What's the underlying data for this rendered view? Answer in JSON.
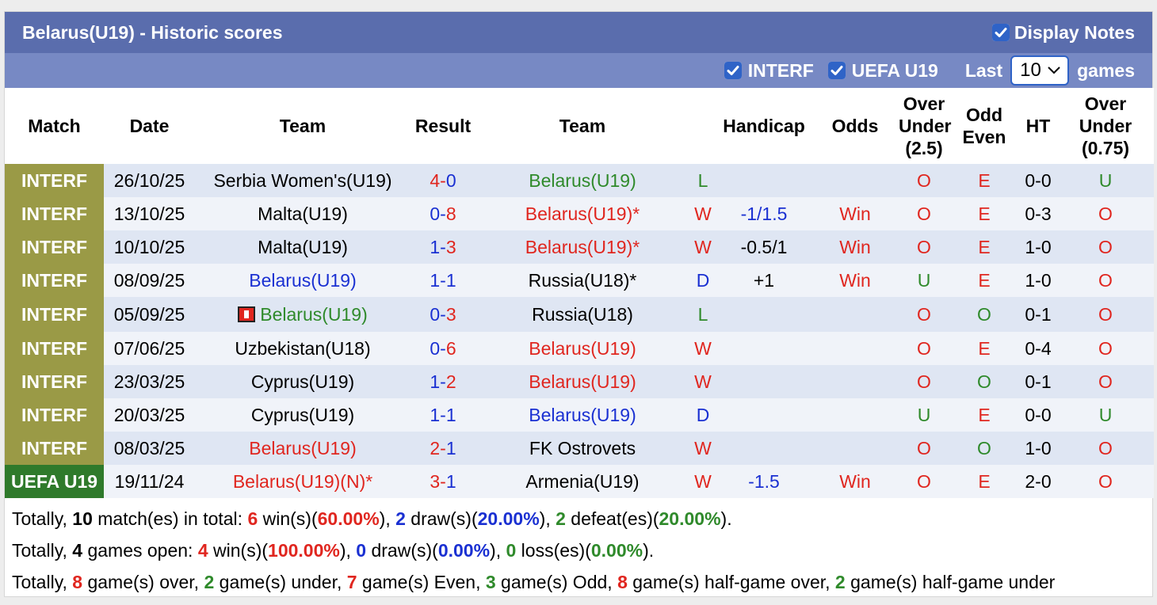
{
  "header": {
    "title": "Belarus(U19) - Historic scores",
    "display_notes_label": "Display Notes",
    "display_notes_checked": true
  },
  "filters": {
    "interf_label": "INTERF",
    "interf_checked": true,
    "uefa_label": "UEFA U19",
    "uefa_checked": true,
    "last_label": "Last",
    "games_value": "10",
    "games_label": "games"
  },
  "columns": {
    "match": "Match",
    "date": "Date",
    "team1": "Team",
    "result": "Result",
    "team2": "Team",
    "handicap": "Handicap",
    "odds": "Odds",
    "over_under_line1": "Over",
    "over_under_line2": "Under",
    "over_under_line3": "(2.5)",
    "odd_even_line1": "Odd",
    "odd_even_line2": "Even",
    "ht": "HT",
    "over_under2_line1": "Over",
    "over_under2_line2": "Under",
    "over_under2_line3": "(0.75)"
  },
  "colors": {
    "red": "#e0261f",
    "blue": "#1a30d2",
    "green": "#2f8a2b",
    "interf_bg": "#9a9a46",
    "uefa_bg": "#2f7a2b",
    "title_bg": "#5a6dad",
    "filter_bg": "#7789c4"
  },
  "rows": [
    {
      "league": "INTERF",
      "date": "26/10/25",
      "team1": "Serbia Women's(U19)",
      "team1_color": "black",
      "flag": false,
      "score_home": "4",
      "score_away": "0",
      "home_color": "red",
      "away_color": "blue",
      "team2": "Belarus(U19)",
      "team2_color": "green",
      "outcome": "L",
      "outcome_color": "green",
      "handicap": "",
      "odds": "",
      "ou": "O",
      "ou_color": "red",
      "oe": "E",
      "oe_color": "red",
      "ht": "0-0",
      "ou2": "U",
      "ou2_color": "green"
    },
    {
      "league": "INTERF",
      "date": "13/10/25",
      "team1": "Malta(U19)",
      "team1_color": "black",
      "flag": false,
      "score_home": "0",
      "score_away": "8",
      "home_color": "blue",
      "away_color": "red",
      "team2": "Belarus(U19)*",
      "team2_color": "red",
      "outcome": "W",
      "outcome_color": "red",
      "handicap": "-1/1.5",
      "handicap_color": "blue",
      "odds": "Win",
      "ou": "O",
      "ou_color": "red",
      "oe": "E",
      "oe_color": "red",
      "ht": "0-3",
      "ou2": "O",
      "ou2_color": "red"
    },
    {
      "league": "INTERF",
      "date": "10/10/25",
      "team1": "Malta(U19)",
      "team1_color": "black",
      "flag": false,
      "score_home": "1",
      "score_away": "3",
      "home_color": "blue",
      "away_color": "red",
      "team2": "Belarus(U19)*",
      "team2_color": "red",
      "outcome": "W",
      "outcome_color": "red",
      "handicap": "-0.5/1",
      "handicap_color": "black",
      "odds": "Win",
      "ou": "O",
      "ou_color": "red",
      "oe": "E",
      "oe_color": "red",
      "ht": "1-0",
      "ou2": "O",
      "ou2_color": "red"
    },
    {
      "league": "INTERF",
      "date": "08/09/25",
      "team1": "Belarus(U19)",
      "team1_color": "blue",
      "flag": false,
      "score_home": "1",
      "score_away": "1",
      "home_color": "blue",
      "away_color": "blue",
      "team2": "Russia(U18)*",
      "team2_color": "black",
      "outcome": "D",
      "outcome_color": "blue",
      "handicap": "+1",
      "handicap_color": "black",
      "odds": "Win",
      "ou": "U",
      "ou_color": "green",
      "oe": "E",
      "oe_color": "red",
      "ht": "1-0",
      "ou2": "O",
      "ou2_color": "red"
    },
    {
      "league": "INTERF",
      "date": "05/09/25",
      "team1": "Belarus(U19)",
      "team1_color": "green",
      "flag": true,
      "score_home": "0",
      "score_away": "3",
      "home_color": "blue",
      "away_color": "red",
      "team2": "Russia(U18)",
      "team2_color": "black",
      "outcome": "L",
      "outcome_color": "green",
      "handicap": "",
      "odds": "",
      "ou": "O",
      "ou_color": "red",
      "oe": "O",
      "oe_color": "green",
      "ht": "0-1",
      "ou2": "O",
      "ou2_color": "red"
    },
    {
      "league": "INTERF",
      "date": "07/06/25",
      "team1": "Uzbekistan(U18)",
      "team1_color": "black",
      "flag": false,
      "score_home": "0",
      "score_away": "6",
      "home_color": "blue",
      "away_color": "red",
      "team2": "Belarus(U19)",
      "team2_color": "red",
      "outcome": "W",
      "outcome_color": "red",
      "handicap": "",
      "odds": "",
      "ou": "O",
      "ou_color": "red",
      "oe": "E",
      "oe_color": "red",
      "ht": "0-4",
      "ou2": "O",
      "ou2_color": "red"
    },
    {
      "league": "INTERF",
      "date": "23/03/25",
      "team1": "Cyprus(U19)",
      "team1_color": "black",
      "flag": false,
      "score_home": "1",
      "score_away": "2",
      "home_color": "blue",
      "away_color": "red",
      "team2": "Belarus(U19)",
      "team2_color": "red",
      "outcome": "W",
      "outcome_color": "red",
      "handicap": "",
      "odds": "",
      "ou": "O",
      "ou_color": "red",
      "oe": "O",
      "oe_color": "green",
      "ht": "0-1",
      "ou2": "O",
      "ou2_color": "red"
    },
    {
      "league": "INTERF",
      "date": "20/03/25",
      "team1": "Cyprus(U19)",
      "team1_color": "black",
      "flag": false,
      "score_home": "1",
      "score_away": "1",
      "home_color": "blue",
      "away_color": "blue",
      "team2": "Belarus(U19)",
      "team2_color": "blue",
      "outcome": "D",
      "outcome_color": "blue",
      "handicap": "",
      "odds": "",
      "ou": "U",
      "ou_color": "green",
      "oe": "E",
      "oe_color": "red",
      "ht": "0-0",
      "ou2": "U",
      "ou2_color": "green"
    },
    {
      "league": "INTERF",
      "date": "08/03/25",
      "team1": "Belarus(U19)",
      "team1_color": "red",
      "flag": false,
      "score_home": "2",
      "score_away": "1",
      "home_color": "red",
      "away_color": "blue",
      "team2": "FK Ostrovets",
      "team2_color": "black",
      "outcome": "W",
      "outcome_color": "red",
      "handicap": "",
      "odds": "",
      "ou": "O",
      "ou_color": "red",
      "oe": "O",
      "oe_color": "green",
      "ht": "1-0",
      "ou2": "O",
      "ou2_color": "red"
    },
    {
      "league": "UEFA U19",
      "date": "19/11/24",
      "team1": "Belarus(U19)(N)*",
      "team1_color": "red",
      "flag": false,
      "score_home": "3",
      "score_away": "1",
      "home_color": "red",
      "away_color": "blue",
      "team2": "Armenia(U19)",
      "team2_color": "black",
      "outcome": "W",
      "outcome_color": "red",
      "handicap": "-1.5",
      "handicap_color": "blue",
      "odds": "Win",
      "ou": "O",
      "ou_color": "red",
      "oe": "E",
      "oe_color": "red",
      "ht": "2-0",
      "ou2": "O",
      "ou2_color": "red"
    }
  ],
  "score_separator": "-",
  "summary": {
    "line1": {
      "prefix": "Totally, ",
      "matches": "10",
      "t1": " match(es) in total: ",
      "wins": "6",
      "t2": " win(s)(",
      "win_pct": "60.00%",
      "t3": "), ",
      "draws": "2",
      "t4": " draw(s)(",
      "draw_pct": "20.00%",
      "t5": "), ",
      "defeats": "2",
      "t6": " defeat(es)(",
      "defeat_pct": "20.00%",
      "t7": ")."
    },
    "line2": {
      "prefix": "Totally, ",
      "games_open": "4",
      "t1": " games open: ",
      "wins": "4",
      "t2": " win(s)(",
      "win_pct": "100.00%",
      "t3": "), ",
      "draws": "0",
      "t4": " draw(s)(",
      "draw_pct": "0.00%",
      "t5": "), ",
      "losses": "0",
      "t6": " loss(es)(",
      "loss_pct": "0.00%",
      "t7": ")."
    },
    "line3": {
      "prefix": "Totally, ",
      "over": "8",
      "t1": " game(s) over, ",
      "under": "2",
      "t2": " game(s) under, ",
      "even": "7",
      "t3": " game(s) Even, ",
      "odd": "3",
      "t4": " game(s) Odd, ",
      "hg_over": "8",
      "t5": " game(s) half-game over, ",
      "hg_under": "2",
      "t6": " game(s) half-game under"
    }
  }
}
